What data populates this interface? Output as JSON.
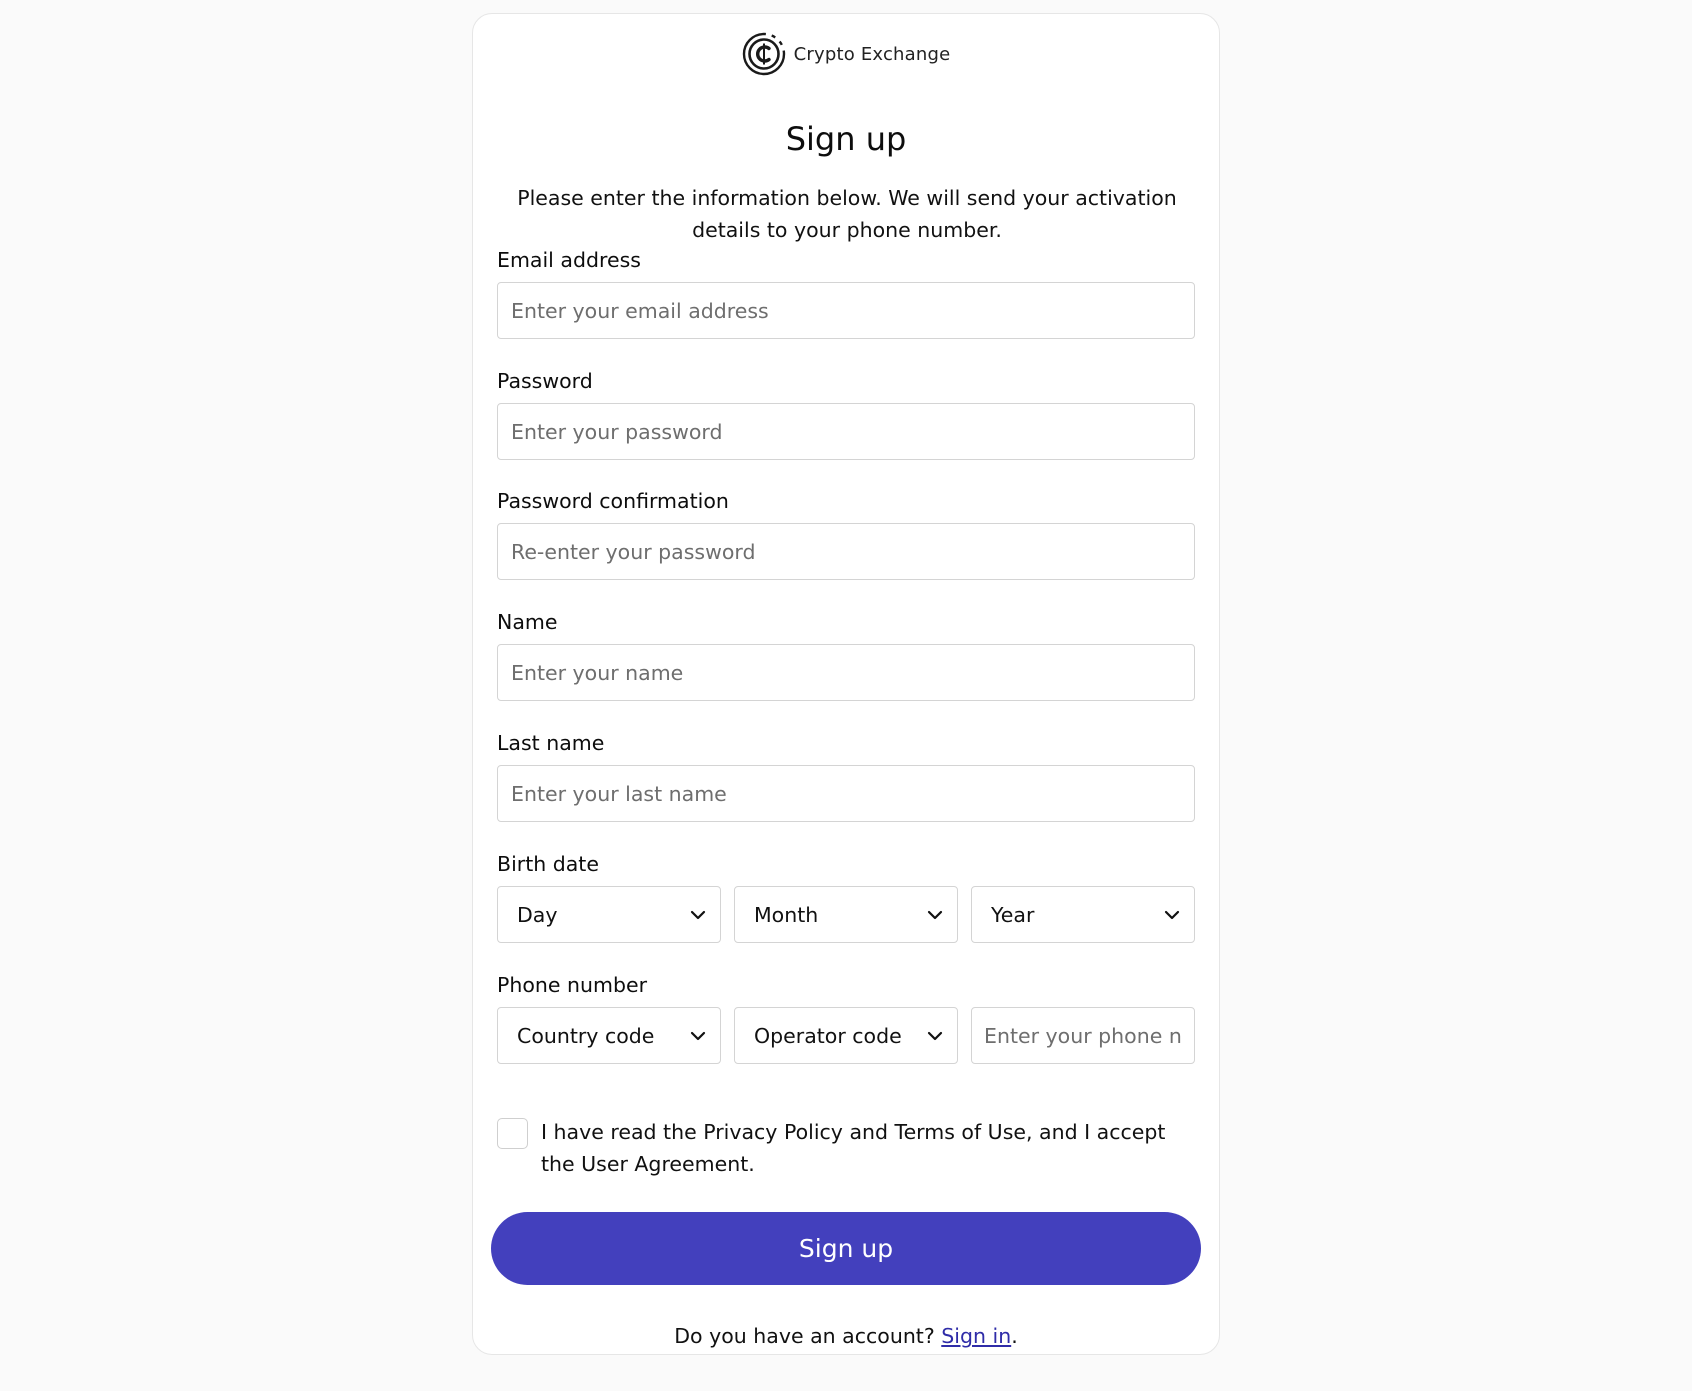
{
  "brand": {
    "name": "Crypto Exchange",
    "logo_icon": "crypto-coin-logo-icon"
  },
  "form": {
    "title": "Sign up",
    "subtitle": "Please enter the information below. We will send your activation details to your phone number.",
    "email": {
      "label": "Email address",
      "placeholder": "Enter your email address",
      "value": ""
    },
    "password": {
      "label": "Password",
      "placeholder": "Enter your password",
      "value": ""
    },
    "password_confirmation": {
      "label": "Password confirmation",
      "placeholder": "Re-enter your password",
      "value": ""
    },
    "name": {
      "label": "Name",
      "placeholder": "Enter your name",
      "value": ""
    },
    "last_name": {
      "label": "Last name",
      "placeholder": "Enter your last name",
      "value": ""
    },
    "birth_date": {
      "label": "Birth date",
      "day": "Day",
      "month": "Month",
      "year": "Year"
    },
    "phone": {
      "label": "Phone number",
      "country_code": "Country code",
      "operator_code": "Operator code",
      "placeholder": "Enter your phone number"
    },
    "agreement": {
      "checked": false,
      "text": "I have read the Privacy Policy and Terms of Use, and I accept the User Agreement."
    },
    "submit_label": "Sign up",
    "footer": {
      "prompt": "Do you have an account?",
      "link": "Sign in",
      "suffix": "."
    }
  },
  "colors": {
    "page_background": "#fafafa",
    "primary_button": "#4340bd",
    "link": "#2f2ca8",
    "input_border": "#d4d4d4"
  },
  "icons": {
    "dropdown": "chevron-down-icon"
  }
}
